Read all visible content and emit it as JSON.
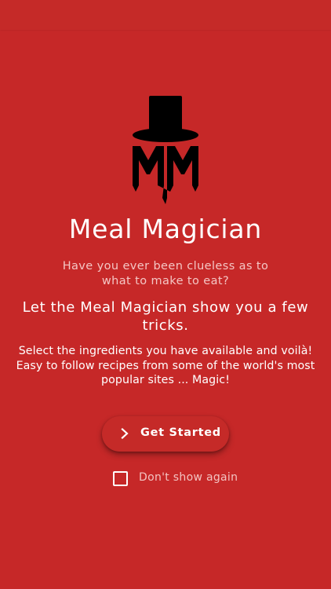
{
  "app": {
    "title": "Meal Magician",
    "logo_text": "MM"
  },
  "intro": {
    "tagline": "Have you ever been clueless as to what to make to eat?",
    "headline": "Let the Meal Magician show you a few tricks.",
    "description": "Select the ingredients you have available and voilà! Easy to follow recipes from some of the world's most popular sites ... Magic!"
  },
  "actions": {
    "get_started_label": "Get Started",
    "get_started_icon": "chevron-right-icon",
    "dont_show_again_label": "Don't show again",
    "dont_show_again_checked": false
  },
  "colors": {
    "background": "#c62828",
    "text": "#ffffff",
    "muted_text": "#f4c6c4",
    "logo": "#000000"
  }
}
